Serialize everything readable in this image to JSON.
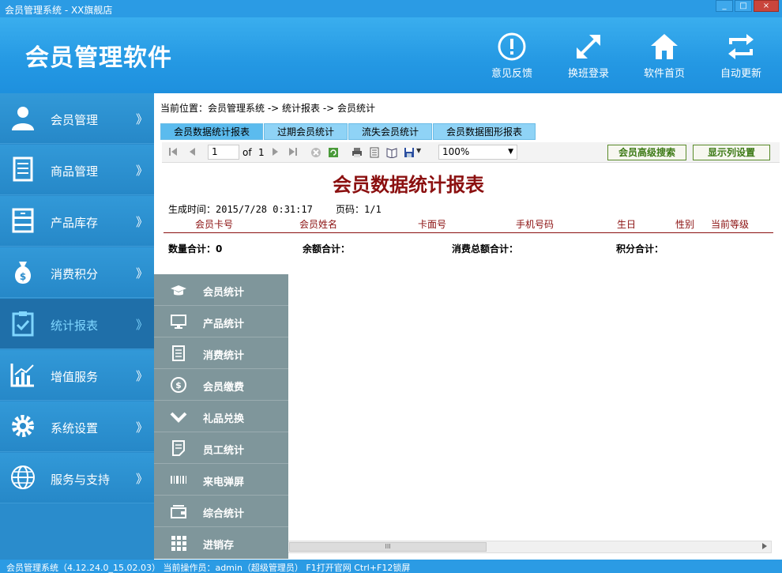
{
  "window": {
    "title": "会员管理系统 - XX旗舰店",
    "minimize": "_",
    "maximize": "□",
    "close": "×"
  },
  "header": {
    "app_title": "会员管理软件",
    "buttons": [
      {
        "label": "意见反馈",
        "icon": "alert-icon"
      },
      {
        "label": "换班登录",
        "icon": "expand-arrows-icon"
      },
      {
        "label": "软件首页",
        "icon": "home-icon"
      },
      {
        "label": "自动更新",
        "icon": "refresh-icon"
      }
    ]
  },
  "sidebar": {
    "chevron": "》",
    "items": [
      {
        "label": "会员管理",
        "icon": "user-icon"
      },
      {
        "label": "商品管理",
        "icon": "document-icon"
      },
      {
        "label": "产品库存",
        "icon": "cabinet-icon"
      },
      {
        "label": "消费积分",
        "icon": "money-bag-icon"
      },
      {
        "label": "统计报表",
        "icon": "clipboard-check-icon"
      },
      {
        "label": "增值服务",
        "icon": "chart-icon"
      },
      {
        "label": "系统设置",
        "icon": "gear-icon"
      },
      {
        "label": "服务与支持",
        "icon": "globe-icon"
      }
    ]
  },
  "submenu": {
    "items": [
      {
        "label": "会员统计",
        "icon": "graduation-cap-icon"
      },
      {
        "label": "产品统计",
        "icon": "monitor-icon"
      },
      {
        "label": "消费统计",
        "icon": "scroll-icon"
      },
      {
        "label": "会员缴费",
        "icon": "dollar-circle-icon"
      },
      {
        "label": "礼品兑换",
        "icon": "chevron-icon"
      },
      {
        "label": "员工统计",
        "icon": "note-icon"
      },
      {
        "label": "来电弹屏",
        "icon": "barcode-icon"
      },
      {
        "label": "综合统计",
        "icon": "wallet-icon"
      },
      {
        "label": "进销存",
        "icon": "grid-icon"
      }
    ]
  },
  "main": {
    "breadcrumb": "当前位置：会员管理系统 -> 统计报表 -> 会员统计",
    "tabs": [
      "会员数据统计报表",
      "过期会员统计",
      "流失会员统计",
      "会员数据图形报表"
    ],
    "toolbar": {
      "page_value": "1",
      "of_label": "of",
      "total_pages": "1",
      "zoom": "100%",
      "zoom_arrow": "▼",
      "search_button": "会员高级搜索",
      "columns_button": "显示列设置"
    },
    "report": {
      "title": "会员数据统计报表",
      "generated": "生成时间：2015/7/28 0:31:17",
      "page": "页码：1/1",
      "columns": [
        "会员卡号",
        "会员姓名",
        "卡面号",
        "手机号码",
        "生日",
        "性别",
        "当前等级"
      ],
      "summary": [
        "数量合计：0",
        "余额合计：",
        "消费总额合计：",
        "积分合计："
      ]
    },
    "hscroll": "III"
  },
  "statusbar": {
    "text": "会员管理系统（4.12.24.0_15.02.03） 当前操作员：admin（超级管理员） F1打开官网 Ctrl+F12锁屏"
  }
}
